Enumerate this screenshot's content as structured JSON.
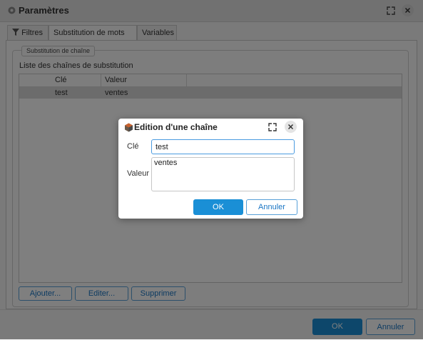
{
  "window": {
    "title": "Paramètres",
    "icon": "gear-icon",
    "controls": {
      "maximize_icon": "expand-icon",
      "close_icon": "close-icon"
    }
  },
  "tabs": [
    {
      "label": "Filtres",
      "icon": "filter-icon",
      "active": false
    },
    {
      "label": "Substitution de mots",
      "active": true
    },
    {
      "label": "Variables",
      "active": false
    }
  ],
  "fieldset": {
    "legend": "Substitution de chaîne"
  },
  "list": {
    "label": "Liste des chaînes de substitution",
    "columns": [
      "Clé",
      "Valeur"
    ],
    "rows": [
      {
        "key": "test",
        "value": "ventes"
      }
    ]
  },
  "actions": {
    "add": "Ajouter...",
    "edit": "Editer...",
    "delete": "Supprimer"
  },
  "footer": {
    "ok": "OK",
    "cancel": "Annuler"
  },
  "dialog": {
    "title": "Edition d'une chaîne",
    "icon": "cube-icon",
    "key_label": "Clé",
    "key_value": "test",
    "value_label": "Valeur",
    "value_value": "ventes",
    "ok": "OK",
    "cancel": "Annuler"
  },
  "colors": {
    "accent": "#1a8fd6",
    "button_border": "#58a0d8",
    "overlay": "rgba(0,0,0,0.5)"
  }
}
